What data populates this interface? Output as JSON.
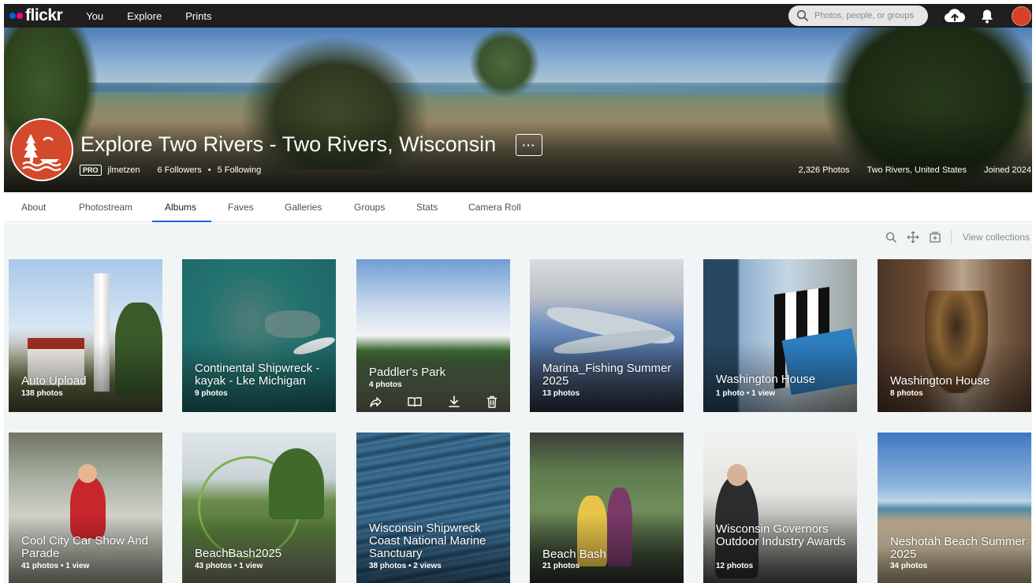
{
  "topnav": {
    "logo": "flickr",
    "links": [
      "You",
      "Explore",
      "Prints"
    ],
    "search_placeholder": "Photos, people, or groups"
  },
  "profile": {
    "title": "Explore Two Rivers - Two Rivers, Wisconsin",
    "more_label": "···",
    "pro_badge": "PRO",
    "username": "jlmetzen",
    "followers": "6 Followers",
    "following": "5 Following",
    "photos": "2,326 Photos",
    "location": "Two Rivers, United States",
    "joined": "Joined 2024"
  },
  "tabs": [
    {
      "label": "About"
    },
    {
      "label": "Photostream"
    },
    {
      "label": "Albums",
      "active": true
    },
    {
      "label": "Faves"
    },
    {
      "label": "Galleries"
    },
    {
      "label": "Groups"
    },
    {
      "label": "Stats"
    },
    {
      "label": "Camera Roll"
    }
  ],
  "toolbar": {
    "view_collections": "View collections"
  },
  "albums": [
    {
      "title": "Auto Upload",
      "meta": "138 photos"
    },
    {
      "title": "Continental Shipwreck - kayak - Lke Michigan",
      "meta": "9 photos"
    },
    {
      "title": "Paddler's Park",
      "meta": "4 photos"
    },
    {
      "title": "Marina_Fishing Summer 2025",
      "meta": "13 photos"
    },
    {
      "title": "Washington House",
      "meta": "1 photo  •  1 view"
    },
    {
      "title": "Washington House",
      "meta": "8 photos"
    },
    {
      "title": "Cool City Car Show And Parade",
      "meta": "41 photos  •  1 view"
    },
    {
      "title": "BeachBash2025",
      "meta": "43 photos  •  1 view"
    },
    {
      "title": "Wisconsin Shipwreck Coast National Marine Sanctuary",
      "meta": "38 photos  •  2 views"
    },
    {
      "title": "Beach Bash",
      "meta": "21 photos"
    },
    {
      "title": "Wisconsin Governors Outdoor Industry Awards",
      "meta": "12 photos"
    },
    {
      "title": "Neshotah Beach Summer 2025",
      "meta": "34 photos"
    }
  ],
  "colors": {
    "nav_bg": "#1f1f1f",
    "accent_blue": "#0063dc",
    "accent_pink": "#ff0084",
    "avatar_red": "#d4482b",
    "content_bg": "#f2f5f6"
  }
}
